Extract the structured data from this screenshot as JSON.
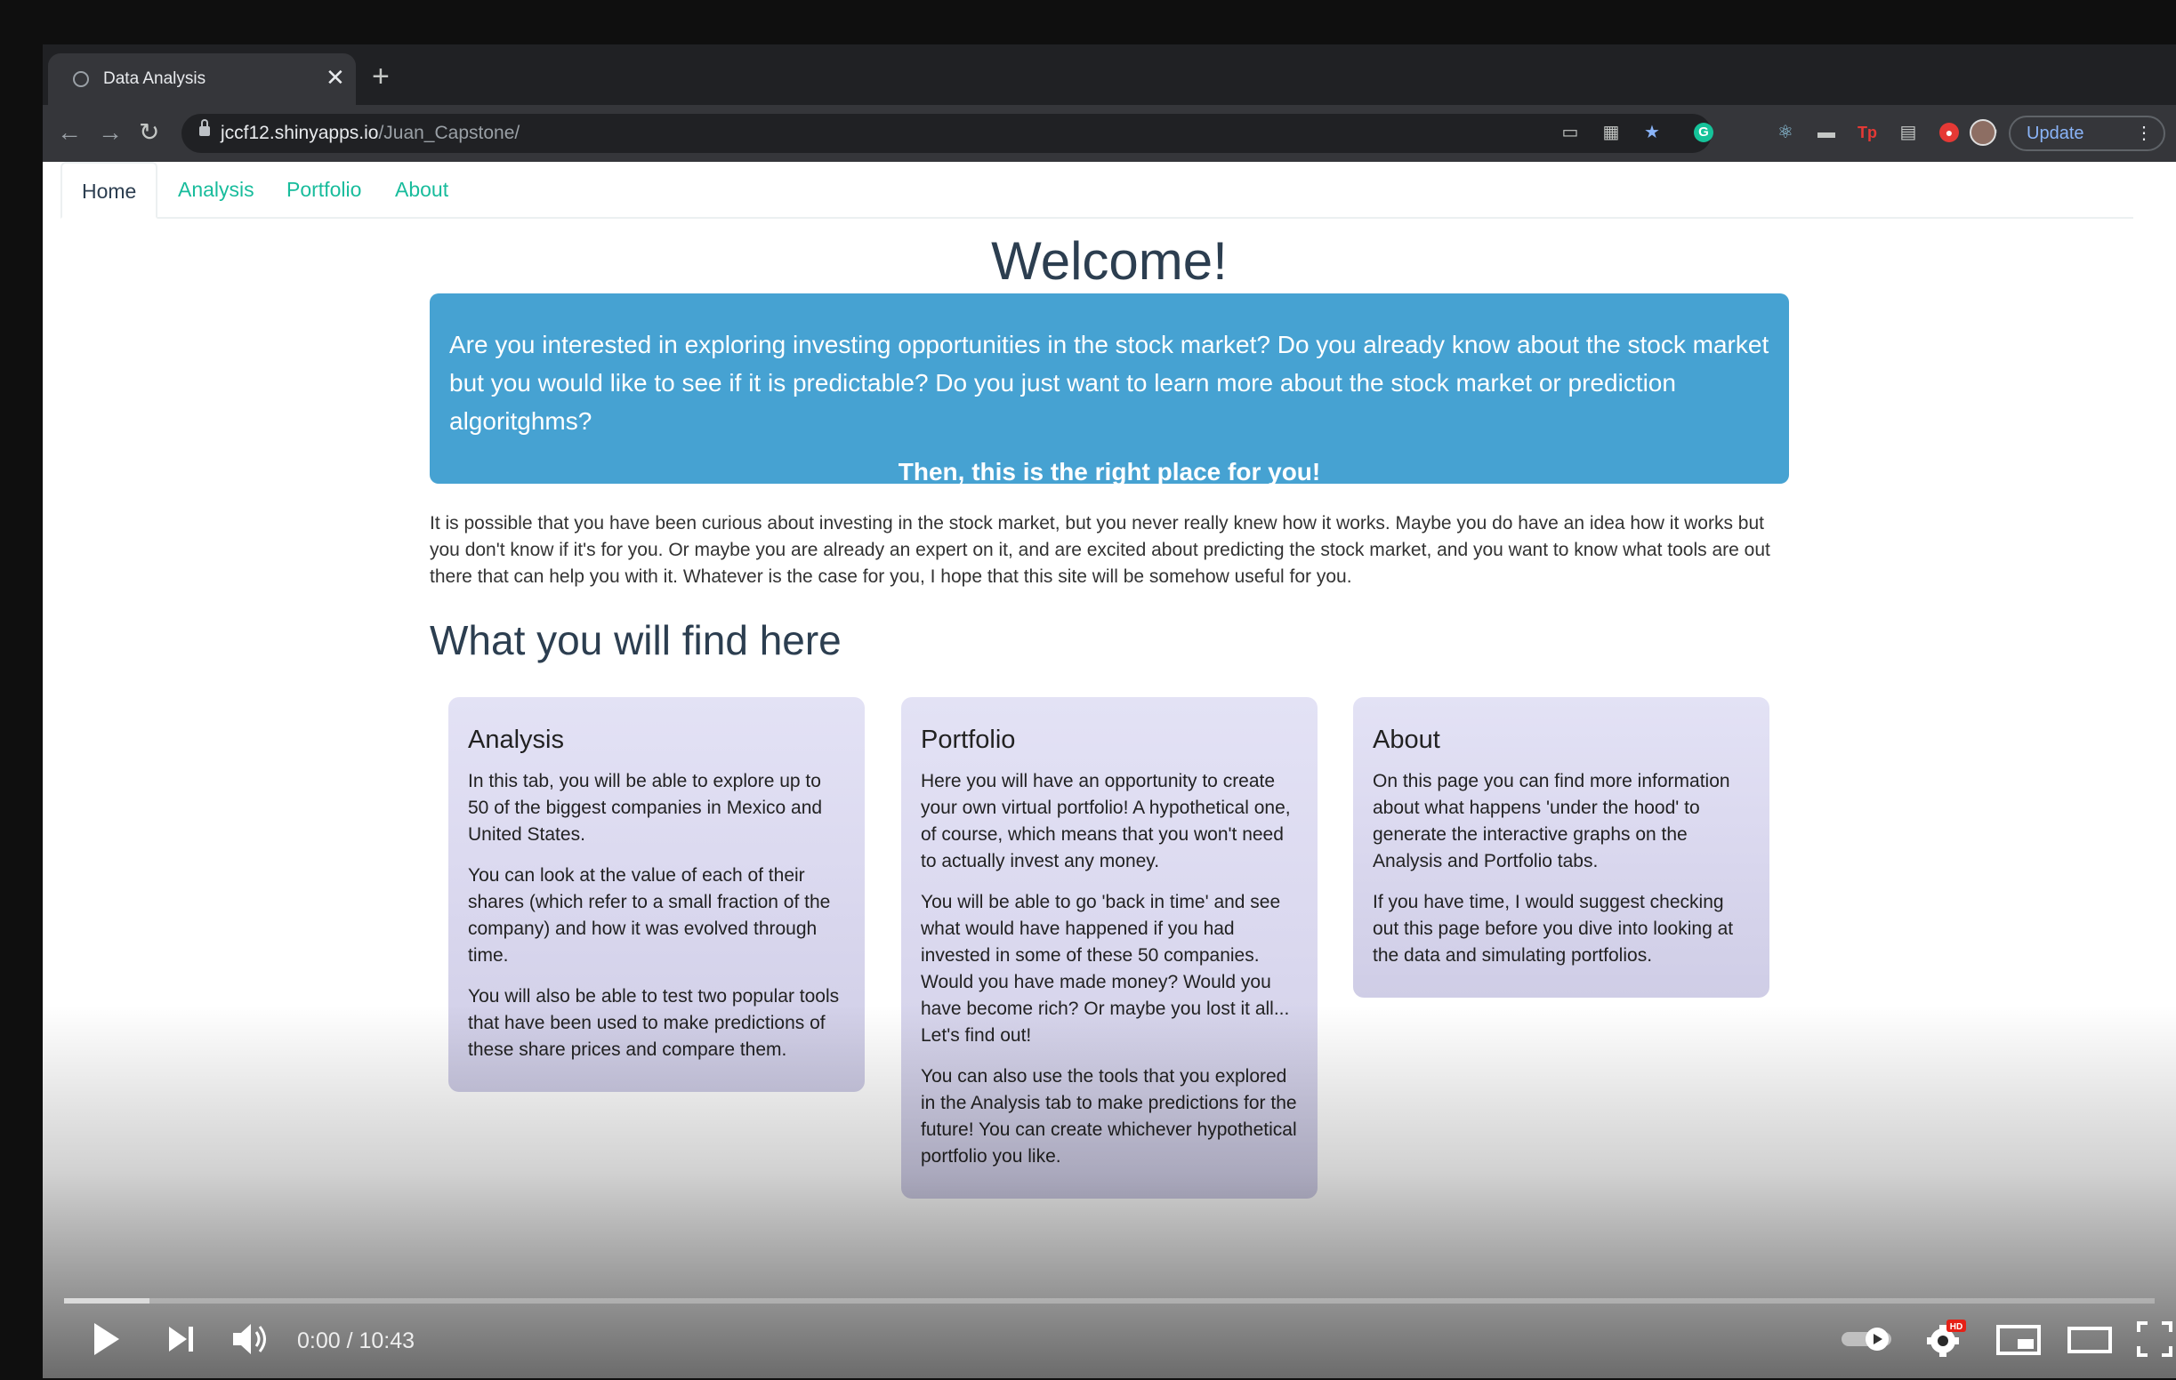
{
  "browser": {
    "tab_title": "Data Analysis",
    "tab_close": "✕",
    "new_tab": "+",
    "url_host": "jccf12.shinyapps.io",
    "url_path": "/Juan_Capstone/",
    "update_label": "Update",
    "update_menu": "⋮"
  },
  "nav": {
    "tabs": [
      "Home",
      "Analysis",
      "Portfolio",
      "About"
    ],
    "active": "Home"
  },
  "hero": {
    "title": "Welcome!",
    "question": "Are you interested in exploring investing opportunities in the stock market? Do you already know about the stock market but you would like to see if it is predictable? Do you just want to learn more about the stock market or prediction algoritghms?",
    "tagline": "Then, this is the right place for you!"
  },
  "intro": "It is possible that you have been curious about investing in the stock market, but you never really knew how it works. Maybe you do have an idea how it works but you don't know if it's for you. Or maybe you are already an expert on it, and are excited about predicting the stock market, and you want to know what tools are out there that can help you with it. Whatever is the case for you, I hope that this site will be somehow useful for you.",
  "section_title": "What you will find here",
  "cards": [
    {
      "title": "Analysis",
      "paragraphs": [
        "In this tab, you will be able to explore up to 50 of the biggest companies in Mexico and United States.",
        "You can look at the value of each of their shares (which refer to a small fraction of the company) and how it was evolved through time.",
        "You will also be able to test two popular tools that have been used to make predictions of these share prices and compare them."
      ]
    },
    {
      "title": "Portfolio",
      "paragraphs": [
        "Here you will have an opportunity to create your own virtual portfolio! A hypothetical one, of course, which means that you won't need to actually invest any money.",
        "You will be able to go 'back in time' and see what would have happened if you had invested in some of these 50 companies. Would you have made money? Would you have become rich? Or maybe you lost it all... Let's find out!",
        "You can also use the tools that you explored in the Analysis tab to make predictions for the future! You can create whichever hypothetical portfolio you like."
      ]
    },
    {
      "title": "About",
      "paragraphs": [
        "On this page you can find more information about what happens 'under the hood' to generate the interactive graphs on the Analysis and Portfolio tabs.",
        "If you have time, I would suggest checking out this page before you dive into looking at the data and simulating portfolios."
      ]
    }
  ],
  "player": {
    "time": "0:00 / 10:43",
    "loaded_fraction": 0.041,
    "played_fraction": 0.0,
    "hd_badge": "HD"
  },
  "colors": {
    "accent_teal": "#18bc9c",
    "hero_blue": "#46a2d2",
    "heading": "#2c3e50"
  }
}
